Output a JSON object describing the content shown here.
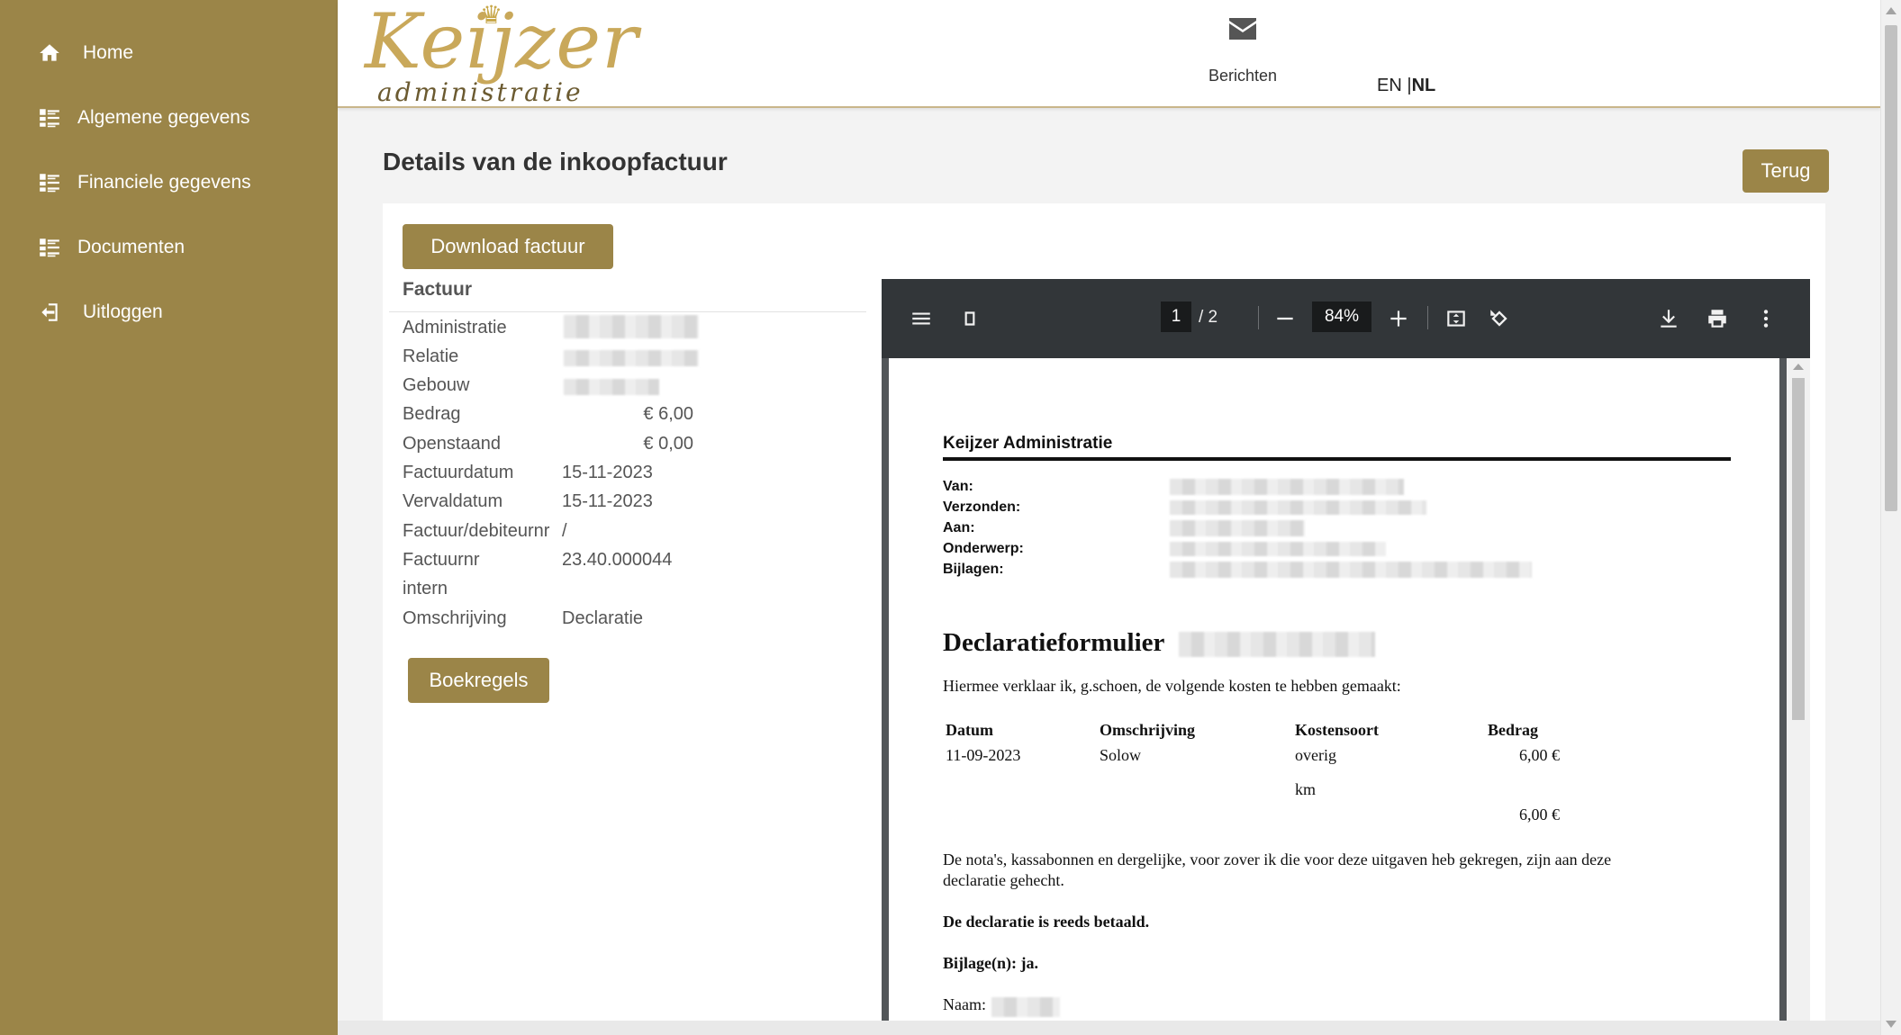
{
  "sidebar": {
    "items": [
      {
        "label": "Home",
        "icon": "home-icon"
      },
      {
        "label": "Algemene gegevens",
        "icon": "list-icon"
      },
      {
        "label": "Financiele gegevens",
        "icon": "list-icon"
      },
      {
        "label": "Documenten",
        "icon": "list-icon"
      },
      {
        "label": "Uitloggen",
        "icon": "logout-icon"
      }
    ]
  },
  "header": {
    "logo_top": "Keijzer",
    "logo_bottom": "administratie",
    "messages_label": "Berichten",
    "lang_en": "EN",
    "lang_sep": " |",
    "lang_nl": "NL"
  },
  "main": {
    "title": "Details van de inkoopfactuur",
    "back_button": "Terug",
    "download_button": "Download factuur",
    "section_title": "Factuur",
    "fields": {
      "administratie": {
        "label": "Administratie"
      },
      "relatie": {
        "label": "Relatie"
      },
      "gebouw": {
        "label": "Gebouw"
      },
      "bedrag": {
        "label": "Bedrag",
        "value": "€ 6,00"
      },
      "openstaand": {
        "label": "Openstaand",
        "value": "€ 0,00"
      },
      "factuurdatum": {
        "label": "Factuurdatum",
        "value": "15-11-2023"
      },
      "vervaldatum": {
        "label": "Vervaldatum",
        "value": "15-11-2023"
      },
      "factuur_debiteurnr": {
        "label": "Factuur/debiteurnr",
        "value": "/"
      },
      "factuurnr_intern": {
        "label_1": "Factuurnr",
        "label_2": "intern",
        "value": "23.40.000044"
      },
      "omschrijving": {
        "label": "Omschrijving",
        "value": "Declaratie"
      }
    },
    "boekregels_button": "Boekregels"
  },
  "pdf": {
    "page_current": "1",
    "page_total": "/  2",
    "zoom": "84%",
    "toolbar_icons": [
      "menu-icon",
      "sidebar-toggle-icon",
      "zoom-out-icon",
      "zoom-in-icon",
      "fit-page-icon",
      "rotate-icon",
      "download-icon",
      "print-icon",
      "more-icon"
    ],
    "doc": {
      "company": "Keijzer Administratie",
      "meta_labels": [
        "Van:",
        "Verzonden:",
        "Aan:",
        "Onderwerp:",
        "Bijlagen:"
      ],
      "heading": "Declaratieformulier",
      "intro": "Hiermee verklaar ik, g.schoen, de volgende kosten te hebben gemaakt:",
      "table": {
        "headers": [
          "Datum",
          "Omschrijving",
          "Kostensoort",
          "Bedrag"
        ],
        "row": [
          "11-09-2023",
          "Solow",
          "overig",
          "6,00 €"
        ],
        "unit": "km",
        "total": "6,00 €"
      },
      "note_1": "De nota's, kassabonnen en dergelijke, voor zover ik die voor deze uitgaven heb gekregen, zijn aan deze",
      "note_2": "declaratie gehecht.",
      "paid": "De declaratie is reeds betaald.",
      "attachments": "Bijlage(n): ja.",
      "name_label": "Naam:"
    }
  }
}
